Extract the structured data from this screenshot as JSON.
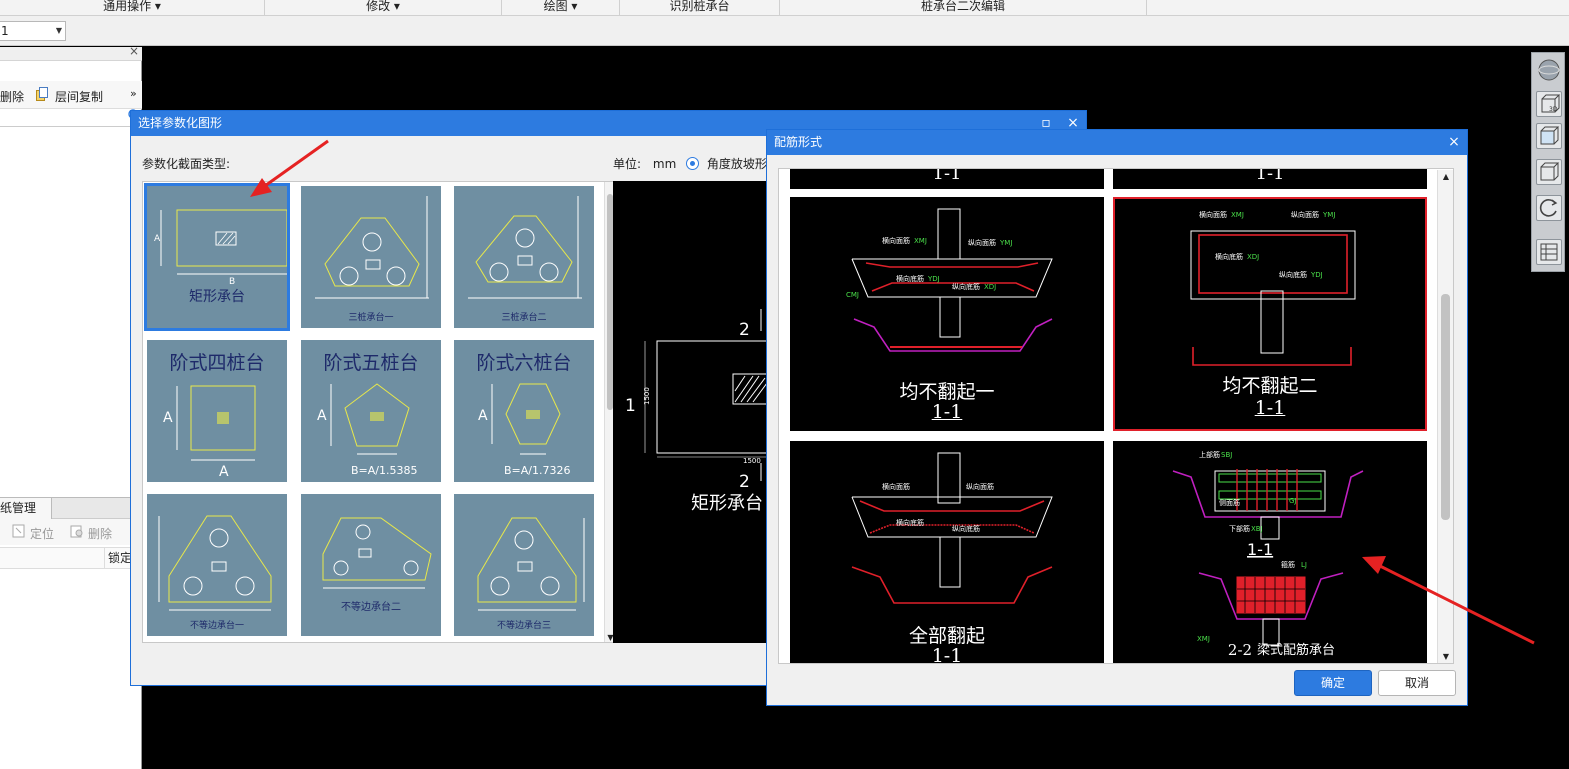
{
  "ribbon": {
    "groups": [
      {
        "label": "通用操作",
        "has_dropdown": true
      },
      {
        "label": "修改",
        "has_dropdown": true
      },
      {
        "label": "绘图",
        "has_dropdown": true
      },
      {
        "label": "识别桩承台",
        "has_dropdown": false
      },
      {
        "label": "桩承台二次编辑",
        "has_dropdown": false
      }
    ]
  },
  "toolbar": {
    "layer_value": "1"
  },
  "left_panel": {
    "delete_label": "删除",
    "copy_between_floors_label": "层间复制",
    "more_label": "»",
    "bottom_tab_label": "纸管理",
    "locate_label": "定位",
    "delete2_label": "删除",
    "lock_column": "锁定"
  },
  "dialog_shape": {
    "title": "选择参数化图形",
    "section_label": "参数化截面类型:",
    "unit_label": "单位:",
    "unit_value": "mm",
    "radio_label": "角度放坡形式",
    "shapes": [
      {
        "name": "矩形承台"
      },
      {
        "name": "三桩承台一"
      },
      {
        "name": "三桩承台二"
      },
      {
        "name": "阶式四桩台"
      },
      {
        "name": "阶式五桩台"
      },
      {
        "name": "阶式六桩台"
      },
      {
        "name": "不等边承台一"
      },
      {
        "name": "不等边承台二"
      },
      {
        "name": "不等边承台三"
      }
    ],
    "shape_labels": {
      "dim_a": "A",
      "dim_b": "B",
      "five_formula": "B=A/1.5385",
      "six_formula": "B=A/1.7326"
    },
    "preview": {
      "label_top": "2",
      "label_left": "1",
      "label_bottom": "2",
      "dim_left": "1500",
      "dim_bottom": "1500",
      "caption": "矩形承台"
    }
  },
  "dialog_rebar": {
    "title": "配筋形式",
    "ok_label": "确定",
    "cancel_label": "取消",
    "section_1_1": "1-1",
    "section_2_2": "2-2",
    "tiles": [
      {
        "caption": "均不翻起一",
        "section": "1-1",
        "selected": false
      },
      {
        "caption": "均不翻起二",
        "section": "1-1",
        "selected": true
      },
      {
        "caption": "全部翻起",
        "section": "1-1",
        "selected": false
      },
      {
        "caption": "梁式配筋承台",
        "section": "2-2",
        "selected": false
      }
    ],
    "drawing_labels": {
      "horizontal_face": "横向面筋",
      "vertical_face": "纵向面筋",
      "horizontal_bottom": "横向底筋",
      "vertical_bottom": "纵向底筋",
      "top_rebar": "上部筋",
      "bottom_rebar": "下部筋",
      "stirrup": "箍筋",
      "side_rebar": "侧面筋",
      "xmj": "XMJ",
      "ymj": "YMJ",
      "xdj": "XDJ",
      "ydj": "YDJ",
      "cmj": "CMJ",
      "sbj": "SBJ",
      "xbj": "XBJ",
      "gj": "GJ",
      "lj": "LJ"
    }
  },
  "colors": {
    "titlebar": "#2d7be0",
    "shape_bg": "#6f8fa2",
    "selection_red": "#e0202a",
    "cad_bg": "#000000"
  }
}
